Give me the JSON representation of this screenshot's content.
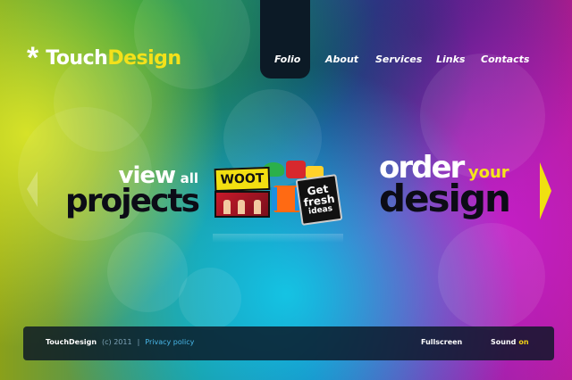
{
  "logo": {
    "symbol": "*",
    "part1": "Touch",
    "part2": "Design",
    "color_primary": "#ffffff",
    "color_accent": "#f3e11a"
  },
  "nav": {
    "items": [
      {
        "label": "Folio",
        "active": true
      },
      {
        "label": "About"
      },
      {
        "label": "Services"
      },
      {
        "label": "Links"
      },
      {
        "label": "Contacts"
      }
    ],
    "active_bg": "#0c1a26"
  },
  "hero": {
    "view_line1_big": "view",
    "view_line1_small": "all",
    "view_line2": "projects",
    "order_line1_big": "order",
    "order_line1_small": "your",
    "order_line2": "design"
  },
  "collage": {
    "woot_text": "WOOT",
    "fresh_line1": "Get",
    "fresh_line2": "fresh",
    "fresh_line3": "ideas"
  },
  "footer": {
    "brand": "TouchDesign",
    "copyright": "(c) 2011",
    "separator": "|",
    "privacy": "Privacy policy",
    "fullscreen": "Fullscreen",
    "sound_label": "Sound",
    "sound_state": "on"
  },
  "icons": {
    "arrow_left": "chevron-left-icon",
    "arrow_right": "chevron-right-icon",
    "logo_star": "asterisk-icon"
  },
  "colors": {
    "arrow_right": "#f0e010",
    "sound_on": "#f3d215",
    "link": "#49b7e8"
  }
}
